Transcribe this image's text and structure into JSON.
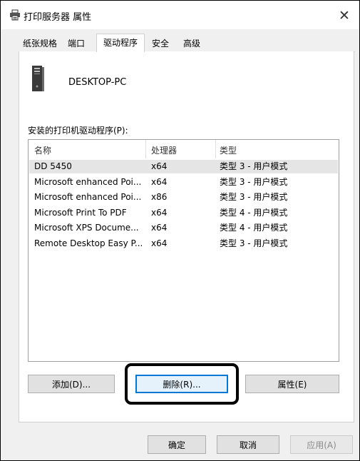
{
  "window": {
    "title": "打印服务器 属性",
    "close_glyph": "✕"
  },
  "tabs": [
    {
      "label": "纸张规格",
      "selected": false
    },
    {
      "label": "端口",
      "selected": false
    },
    {
      "label": "驱动程序",
      "selected": true
    },
    {
      "label": "安全",
      "selected": false
    },
    {
      "label": "高级",
      "selected": false
    }
  ],
  "server": {
    "name": "DESKTOP-PC",
    "icon": "computer-tower-icon"
  },
  "list": {
    "label": "安装的打印机驱动程序(P):",
    "columns": [
      "名称",
      "处理器",
      "类型"
    ],
    "rows": [
      [
        "DD 5450",
        "x64",
        "类型 3 - 用户模式"
      ],
      [
        "Microsoft enhanced Poi...",
        "x64",
        "类型 3 - 用户模式"
      ],
      [
        "Microsoft enhanced Poi...",
        "x86",
        "类型 3 - 用户模式"
      ],
      [
        "Microsoft Print To PDF",
        "x64",
        "类型 4 - 用户模式"
      ],
      [
        "Microsoft XPS Docume...",
        "x64",
        "类型 4 - 用户模式"
      ],
      [
        "Remote Desktop Easy P...",
        "x64",
        "类型 3 - 用户模式"
      ]
    ]
  },
  "buttons": {
    "add": "添加(D)...",
    "remove": "删除(R)...",
    "properties": "属性(E)"
  },
  "footer": {
    "ok": "确定",
    "cancel": "取消",
    "apply": "应用(A)"
  },
  "colors": {
    "focus": "#0078d7",
    "selected_row": "#e5e5e5"
  }
}
